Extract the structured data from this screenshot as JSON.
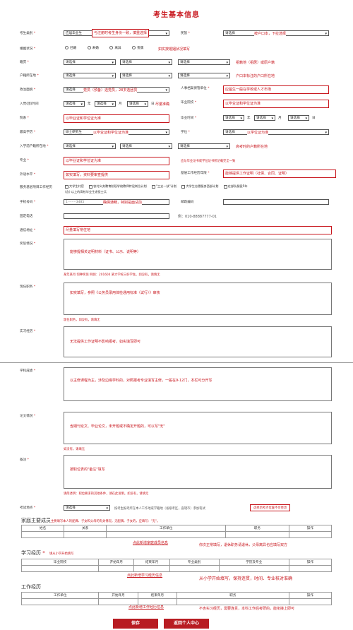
{
  "page_title": "考生基本信息",
  "f": {
    "kslb": "考生类别",
    "kslb_val": "应届毕业生",
    "kslb_note": "与注册时考生身份一致，慎重选择",
    "mz": "民族",
    "mz_val": "请选择",
    "mz_note": "按户口本，下拉选择",
    "hyzk": "婚姻状况",
    "hy_opts": [
      "已婚",
      "未婚",
      "离异",
      "丧偶"
    ],
    "hyzk_note": "如实按婚姻状况填写",
    "jg": "籍贯",
    "jg_note": "祖籍地（祖居）或原户籍",
    "hjszd": "户籍所在地",
    "hjszd_note": "户口本标注的户口所在地",
    "zzmm": "政治面貌",
    "zzmm_val": "请选择",
    "zzmm_note": "党员（预备）选党员，28岁选团员",
    "rdsj": "入党(团)时间",
    "nian": "年",
    "yue": "月",
    "ri": "日",
    "rdsj_note": "尽量准确",
    "drdagl": "人事档案保管单位",
    "drdagl_note": "应届生一般在学校或人才市场",
    "byyx": "毕业院校",
    "byyx_note": "以毕业证和学位证为准",
    "sx": "院系",
    "sx_note": "以毕业证和学位证为准",
    "bysj": "毕业时间",
    "zgxl": "最高学历",
    "zgxl_val": "硕士研究生",
    "zgxl_note": "以毕业证和学位证为准",
    "xw": "学位",
    "xw_note": "以学位证为准",
    "rxqhj": "入学前户籍所在地",
    "rxqhj_note": "高考时的户籍所在地",
    "zy": "专业",
    "zy_note": "以毕业证和学位证为准",
    "zy_hint": "应与毕业证书或学位证书所记载完全一致",
    "wysp": "外语水平",
    "wysp_note": "如实填写，资料要审查提供",
    "jcgzjl": "基层工作经历年限",
    "jcgzjl_note": "能够提供工作证明（社保、合同、证明）",
    "fwjc": "服务基层项目工作经历",
    "fwjc_opts": [
      "大学生村官",
      "农村义务教育阶段学校教师特设岗位计划",
      "\"三支一扶\"计划",
      "大学生志愿服务西部计划",
      "在部队服役5年"
    ],
    "fwjc_opt6": "(含) 以上的高校毕业生退役士兵",
    "sj": "手机号码",
    "sj_val": "1········3485",
    "sj_note": "确保通畅，特别是面试前",
    "yzbm": "邮政编码",
    "gddh": "固定电话",
    "gddh_ph": "例：010-88887777-01",
    "txdz": "通信地址",
    "txdz_note": "尽量填写常住地",
    "jcqk": "奖惩情况",
    "jcqk_note": "能够提相关证明材料（证书、公示、说明等）",
    "jcqk_hint": "某年某月 何种奖惩 例如：201604 某大学校三好学生。如没有，请填无",
    "ztbx": "现任职务",
    "ztbx_note": "如实填写，参照《公务员录用体检通用标准（试行）》审核",
    "ztbx_hint": "现任职务，如没有，请填无",
    "sxjl": "实习经历",
    "sxjl_note": "无法提供工作证明不影响报考，如实填写即可",
    "xkjs": "学科成绩",
    "xkjs_note": "以主修课程为主，涉及边缘学科的，对照报考专业填写主修，一般在9-12门，本栏可分开写",
    "lwqk": "论文情况",
    "lwqk_note": "含期刊论文、毕业论文，未开题或不确定开题的，可以写\"无\"",
    "lwqk_hint": "如没有，请填无",
    "bz": "备注",
    "bz_note": "按职位表的\"备注\"填写",
    "bz_hint": "请简述明：职位要求的其他条件，请在此说明。如没有，请填无",
    "ksdd": "考试地点",
    "ksdd_val": "请选择",
    "ksdd_text": "按考生报考所在本人工作地或学籍地（省级考区，直辖市）参加笔试",
    "ksdd_box": "选择后考点位置不可修改"
  },
  "sel": "请选择",
  "family": {
    "title": "家庭主要成员",
    "hint": "主要填写本人的配偶、子女和父母的有关情况，无配偶、子女的，应填写：\"无\"。",
    "cols": [
      "姓名",
      "关系",
      "工作单位",
      "职务",
      "操作"
    ],
    "add": "点此新增家庭成员信息",
    "note": "你次正常填写，退休职务请退休，父母离异也应填写双方"
  },
  "study": {
    "title": "学习经历",
    "hint": "填从小学开始填写",
    "cols": [
      "毕业院校",
      "开始年月",
      "结束年月",
      "专业类别",
      "学历及专业",
      "操作"
    ],
    "add": "点此新增学习经历信息",
    "note": "从小学开始填写，保持连贯，时间、专业核对准确"
  },
  "work": {
    "title": "工作经历",
    "cols": [
      "工作单位",
      "开始年月",
      "结束年月",
      "职务",
      "操作"
    ],
    "add": "点此新增工作经历信息",
    "note": "不含实习经历，需要连贯，本科工作后考研的，能衔接上即可"
  },
  "buttons": {
    "save": "保存",
    "back": "返回个人中心"
  },
  "colors": {
    "accent": "#c8161d",
    "button": "#b81c22"
  }
}
